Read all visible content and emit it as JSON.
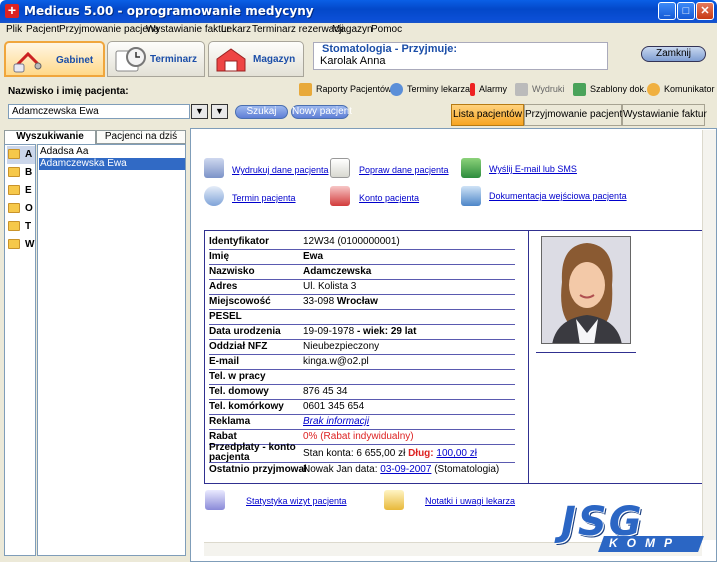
{
  "window": {
    "title": "Medicus 5.00 - oprogramowanie medycyny",
    "controls": [
      "_",
      "□",
      "✕"
    ]
  },
  "menu": [
    "Plik",
    "Pacjent",
    "Przyjmowanie pacjena",
    "Wystawianie faktur",
    "Lekarz",
    "Terminarz rezerwacji",
    "Magazyn",
    "Pomoc"
  ],
  "modules": [
    {
      "label": "Gabinet",
      "active": true
    },
    {
      "label": "Terminarz",
      "active": false
    },
    {
      "label": "Magazyn",
      "active": false
    }
  ],
  "dept": {
    "label": "Stomatologia - Przyjmuje:",
    "doctor": "Karolak Anna"
  },
  "close_label": "Zamknij",
  "search": {
    "label": "Nazwisko i imię pacjenta:",
    "value": "Adamczewska Ewa",
    "search_btn": "Szukaj",
    "new_btn": "Nowy pacjent"
  },
  "tools": [
    "Raporty Pacjentów",
    "Terminy lekarza",
    "Alarmy",
    "Wydruki",
    "Szablony dok.",
    "Komunikator"
  ],
  "right_tabs": [
    "Lista pacjentów",
    "Przyjmowanie pacjenta",
    "Wystawianie faktur"
  ],
  "left_tabs": [
    "Wyszukiwanie",
    "Pacjenci na dziś"
  ],
  "letters": [
    "A",
    "B",
    "E",
    "O",
    "T",
    "W"
  ],
  "patients": [
    "Adadsa Aa",
    "Adamczewska Ewa"
  ],
  "actions": {
    "print": "Wydrukuj dane pacjenta",
    "edit": "Popraw dane pacjenta",
    "email": "Wyślij E-mail lub SMS",
    "term": "Termin pacjenta",
    "account": "Konto pacjenta",
    "docs": "Dokumentacja wejściowa pacjenta",
    "stats": "Statystyka wizyt pacjenta",
    "notes": "Notatki i uwagi lekarza"
  },
  "fields": {
    "id_label": "Identyfikator",
    "id": "12W34 (0100000001)",
    "imie_label": "Imię",
    "imie": "Ewa",
    "nazwisko_label": "Nazwisko",
    "nazwisko": "Adamczewska",
    "adres_label": "Adres",
    "adres": "Ul. Kolista 3",
    "miejsc_label": "Miejscowość",
    "kod": "33-098",
    "miasto": "Wrocław",
    "pesel_label": "PESEL",
    "urodz_label": "Data urodzenia",
    "urodz": "19-09-1978",
    "wiek": "- wiek: 29 lat",
    "nfz_label": "Oddział NFZ",
    "nfz": "Nieubezpieczony",
    "email_label": "E-mail",
    "email": "kinga.w@o2.pl",
    "tel_praca_label": "Tel. w pracy",
    "tel_dom_label": "Tel. domowy",
    "tel_dom": "876 45 34",
    "tel_kom_label": "Tel. komórkowy",
    "tel_kom": "0601 345 654",
    "reklama_label": "Reklama",
    "reklama": "Brak informacji",
    "rabat_label": "Rabat",
    "rabat": "0% (Rabat indywidualny)",
    "przedplaty_label": "Przedpłaty - konto pacjenta",
    "stan": "Stan konta: 6 655,00 zł",
    "dlug_label": "Dług:",
    "dlug": "100,00 zł",
    "ostatnie_label": "Ostatnio przyjmował",
    "ostatnie_pre": "Nowak Jan data:",
    "ostatnie_date": "03-09-2007",
    "ostatnie_post": "(Stomatologia)"
  },
  "logo": {
    "top": "JSG",
    "bottom": "KOMP"
  }
}
